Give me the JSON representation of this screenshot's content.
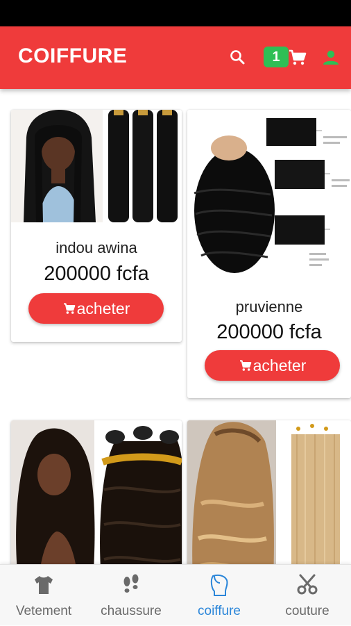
{
  "app": {
    "title": "COIFFURE",
    "cart_count": "1",
    "accent_color": "#ef3b3b",
    "badge_color": "#2ebf55"
  },
  "toolbar": {
    "search_icon": "search-icon",
    "cart_icon": "cart-icon",
    "account_icon": "account-icon"
  },
  "products": [
    {
      "name": "indou awina",
      "price": "200000 fcfa",
      "buy_label": "acheter"
    },
    {
      "name": "pruvienne",
      "price": "200000 fcfa",
      "buy_label": "acheter"
    }
  ],
  "bottom_nav": [
    {
      "label": "Vetement",
      "icon": "tshirt-icon",
      "active": false
    },
    {
      "label": "chaussure",
      "icon": "footprints-icon",
      "active": false
    },
    {
      "label": "coiffure",
      "icon": "head-hair-icon",
      "active": true
    },
    {
      "label": "couture",
      "icon": "scissors-icon",
      "active": false
    }
  ],
  "colors": {
    "active_nav": "#2b86d9",
    "inactive_nav": "#6a6a6a"
  }
}
